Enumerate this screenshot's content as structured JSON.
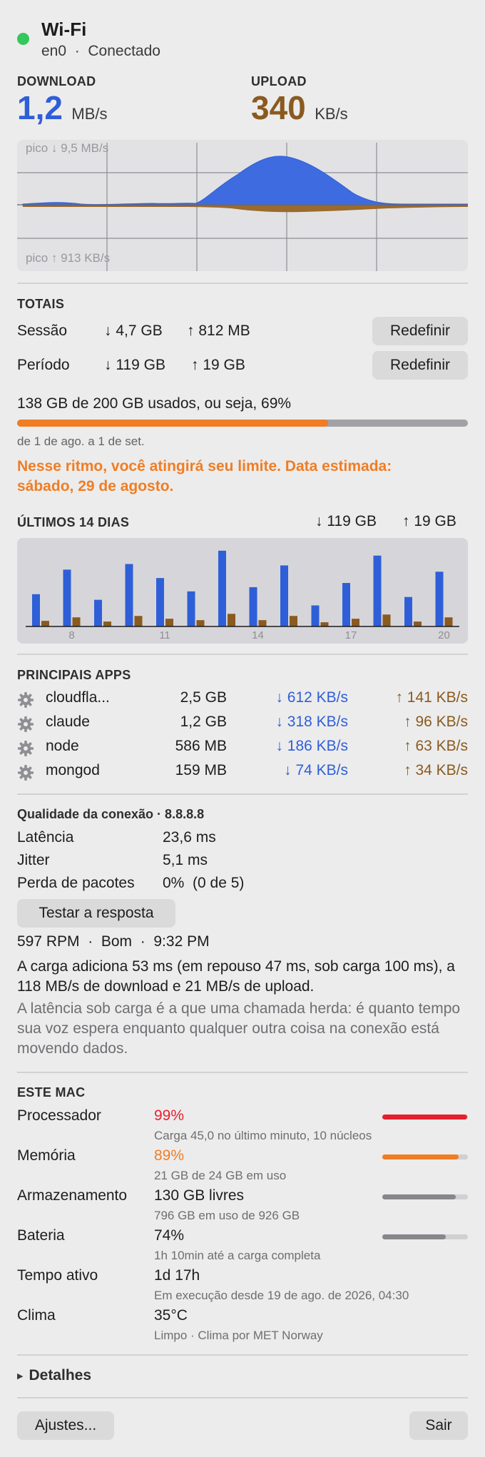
{
  "header": {
    "title": "Wi-Fi",
    "subtitle": "en0  ·  Conectado",
    "status_color": "#34c759"
  },
  "throughput": {
    "download_label": "DOWNLOAD",
    "download_value": "1,2",
    "download_unit": "MB/s",
    "upload_label": "UPLOAD",
    "upload_value": "340",
    "upload_unit": "KB/s",
    "peak_down": "pico ↓ 9,5 MB/s",
    "peak_up": "pico ↑ 913 KB/s",
    "colors": {
      "download": "#2f5fd8",
      "upload": "#8a5a1e"
    }
  },
  "totals": {
    "heading": "TOTAIS",
    "session_label": "Sessão",
    "session_down": "↓ 4,7 GB",
    "session_up": "↑ 812 MB",
    "period_label": "Período",
    "period_down": "↓ 119 GB",
    "period_up": "↑ 19 GB",
    "reset_label": "Redefinir",
    "usage_text": "138 GB de 200 GB usados, ou seja, 69%",
    "usage_fraction": 0.69,
    "period_range": "de 1 de ago. a 1 de set.",
    "warning": "Nesse ritmo, você atingirá seu limite. Data estimada: sábado, 29 de agosto."
  },
  "last14": {
    "heading": "ÚLTIMOS 14 DIAS",
    "total_down": "↓ 119 GB",
    "total_up": "↑ 19 GB",
    "tick_labels": [
      "8",
      "11",
      "14",
      "17",
      "20"
    ]
  },
  "chart_data": {
    "type": "bar",
    "categories": [
      "7",
      "8",
      "9",
      "10",
      "11",
      "12",
      "13",
      "14",
      "15",
      "16",
      "17",
      "18",
      "19",
      "20"
    ],
    "series": [
      {
        "values": [
          4.6,
          8.1,
          3.8,
          8.9,
          6.9,
          5.0,
          10.8,
          5.6,
          8.7,
          3.0,
          6.2,
          10.1,
          4.2,
          7.8
        ]
      },
      {
        "values": [
          0.8,
          1.3,
          0.7,
          1.5,
          1.1,
          0.9,
          1.8,
          0.9,
          1.5,
          0.6,
          1.1,
          1.7,
          0.7,
          1.3
        ]
      }
    ],
    "ylim": [
      0,
      12
    ]
  },
  "apps": {
    "heading": "PRINCIPAIS APPS",
    "rows": [
      {
        "name": "cloudfla...",
        "total": "2,5 GB",
        "down": "↓ 612 KB/s",
        "up": "↑ 141 KB/s",
        "icon": "gear-icon"
      },
      {
        "name": "claude",
        "total": "1,2 GB",
        "down": "↓ 318 KB/s",
        "up": "↑ 96 KB/s",
        "icon": "gear-icon"
      },
      {
        "name": "node",
        "total": "586 MB",
        "down": "↓ 186 KB/s",
        "up": "↑ 63 KB/s",
        "icon": "gear-icon"
      },
      {
        "name": "mongod",
        "total": "159 MB",
        "down": "↓ 74 KB/s",
        "up": "↑ 34 KB/s",
        "icon": "gear-icon"
      }
    ]
  },
  "quality": {
    "heading": "Qualidade da conexão · 8.8.8.8",
    "latency_label": "Latência",
    "latency_value": "23,6 ms",
    "jitter_label": "Jitter",
    "jitter_value": "5,1 ms",
    "loss_label": "Perda de pacotes",
    "loss_value": "0%  (0 de 5)",
    "test_button": "Testar a resposta",
    "rpm_line": "597 RPM  ·  Bom  ·  9:32 PM",
    "load_text": "A carga adiciona 53 ms (em repouso 47 ms, sob carga 100 ms), a 118 MB/s de download e 21 MB/s de upload.",
    "note_text": "A latência sob carga é a que uma chamada herda: é quanto tempo sua voz espera enquanto qualquer outra coisa na conexão está movendo dados."
  },
  "this_mac": {
    "heading": "ESTE MAC",
    "rows": [
      {
        "label": "Processador",
        "value": "99%",
        "detail": "Carga 45,0 no último minuto, 10 núcleos",
        "fraction": 0.99,
        "color": "#e5202e",
        "value_color": "#e5202e"
      },
      {
        "label": "Memória",
        "value": "89%",
        "detail": "21 GB de 24 GB em uso",
        "fraction": 0.89,
        "color": "#f07d24",
        "value_color": "#f07d24"
      },
      {
        "label": "Armazenamento",
        "value": "130 GB livres",
        "detail": "796 GB em uso de 926 GB",
        "fraction": 0.86,
        "color": "#86868b",
        "value_color": "#1d1d1f"
      },
      {
        "label": "Bateria",
        "value": "74%",
        "detail": "1h 10min até a carga completa",
        "fraction": 0.74,
        "color": "#86868b",
        "value_color": "#1d1d1f"
      },
      {
        "label": "Tempo ativo",
        "value": "1d 17h",
        "detail": "Em execução desde 19 de ago. de 2026, 04:30"
      },
      {
        "label": "Clima",
        "value": "35°C",
        "detail": "Limpo  ·  Clima por MET Norway"
      }
    ]
  },
  "footer": {
    "details_label": "Detalhes",
    "settings_button": "Ajustes...",
    "quit_button": "Sair"
  }
}
